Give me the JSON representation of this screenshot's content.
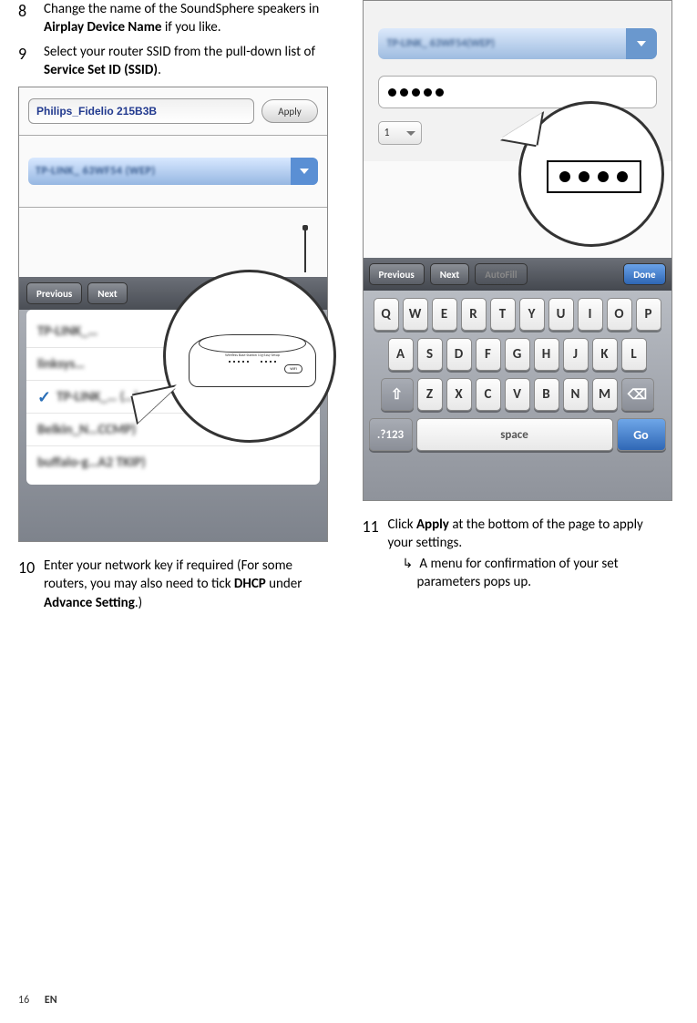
{
  "left": {
    "step8_num": "8",
    "step8_a": "Change the name of the SoundSphere speakers in ",
    "step8_b": "Airplay Device Name",
    "step8_c": " if you like.",
    "step9_num": "9",
    "step9_a": "Select your router SSID from the pull-down list of ",
    "step9_b": "Service Set ID (SSID)",
    "step9_c": ".",
    "device_name": "Philips_Fidelio 215B3B",
    "apply_label": "Apply",
    "ssid_blur": "TP-LINK_ 63WF54 (WEP)",
    "tb_prev": "Previous",
    "tb_next": "Next",
    "wifi_items": [
      "TP-LINK_…",
      "linksys…",
      "TP-LINK_… (…)",
      "Belkin_N…CCMP)",
      "buffalo-g…A2 TKIP)"
    ],
    "router_label": "Wireless Base Station 11g Easy Setup",
    "wifi_logo": "WiFi",
    "step10_num": "10",
    "step10_a": "Enter your network key if required (For some routers, you may also need to tick ",
    "step10_b": "DHCP",
    "step10_c": " under ",
    "step10_d": "Advance Setting",
    "step10_e": ".)"
  },
  "right": {
    "ssid_blur": "TP-LINK_ 63WF54(WEP)",
    "small_dd": "1",
    "tb_prev": "Previous",
    "tb_next": "Next",
    "tb_autofill": "AutoFill",
    "tb_done": "Done",
    "kb_row1": [
      "Q",
      "W",
      "E",
      "R",
      "T",
      "Y",
      "U",
      "I",
      "O",
      "P"
    ],
    "kb_row2": [
      "A",
      "S",
      "D",
      "F",
      "G",
      "H",
      "J",
      "K",
      "L"
    ],
    "kb_row3": [
      "Z",
      "X",
      "C",
      "V",
      "B",
      "N",
      "M"
    ],
    "kb_numtoggle": ".?123",
    "kb_space": "space",
    "kb_go": "Go",
    "step11_num": "11",
    "step11_a": "Click ",
    "step11_b": "Apply",
    "step11_c": " at the bottom of the page to apply your settings.",
    "step11_sub": "A menu for confirmation of your set parameters pops up."
  },
  "footer": {
    "page": "16",
    "lang": "EN"
  }
}
